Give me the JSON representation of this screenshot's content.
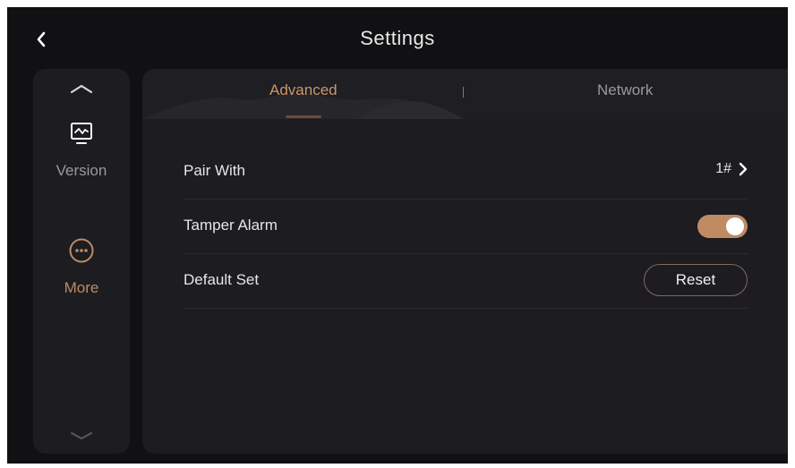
{
  "header": {
    "title": "Settings",
    "back_icon": "chevron-left-icon"
  },
  "sidebar": {
    "items": [
      {
        "label": "Version",
        "icon": "monitor-icon",
        "active": false
      },
      {
        "label": "More",
        "icon": "more-dots-icon",
        "active": true
      }
    ]
  },
  "tabs": [
    {
      "label": "Advanced",
      "active": true
    },
    {
      "label": "Network",
      "active": false
    }
  ],
  "settings": {
    "pair_with": {
      "label": "Pair With",
      "value": "1#"
    },
    "tamper_alarm": {
      "label": "Tamper Alarm",
      "enabled": true
    },
    "default_set": {
      "label": "Default Set",
      "button_label": "Reset"
    }
  },
  "colors": {
    "accent": "#c08a63",
    "background": "#111114",
    "panel": "#1c1c21",
    "text": "#e6e6e6",
    "muted": "#9a9a9a"
  }
}
